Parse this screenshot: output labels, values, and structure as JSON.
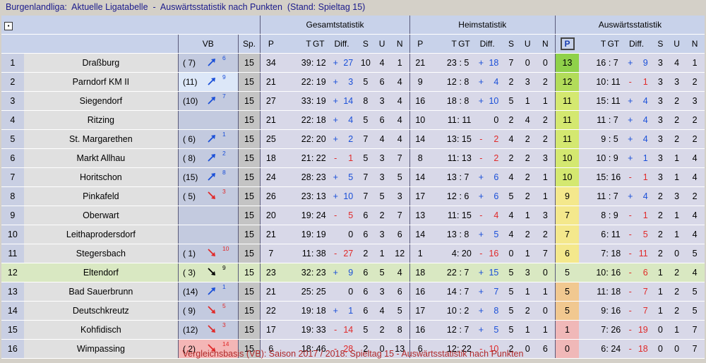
{
  "title": "Burgenlandliga:  Aktuelle Ligatabelle  -  Auswärtsstatistik nach Punkten  (Stand: Spieltag 15)",
  "footer": "Vergleichsbasis (VB): Saison 2017 / 2018: Spieltag 15 - Auswärtsstatistik nach Punkten",
  "header": {
    "groups": {
      "gesamt": "Gesamtstatistik",
      "heim": "Heimstatistik",
      "auswaerts": "Auswärtsstatistik"
    },
    "sort_icon": "▪",
    "vb": "VB",
    "sp": "Sp.",
    "p": "P",
    "t": "T",
    "gt": "GT",
    "diff": "Diff.",
    "s": "S",
    "u": "U",
    "n": "N"
  },
  "rows": [
    {
      "rank": "1",
      "team": "Draßburg",
      "vb_prev": "( 7)",
      "vb_dir": "up",
      "vb_change": "6",
      "sp": "15",
      "g": {
        "p": "34",
        "t": "39",
        "gt": "12",
        "ds": "+",
        "dv": "27",
        "s": "10",
        "u": "4",
        "n": "1"
      },
      "h": {
        "p": "21",
        "t": "23",
        "gt": "5",
        "ds": "+",
        "dv": "18",
        "s": "7",
        "u": "0",
        "n": "0"
      },
      "a": {
        "p": "13",
        "t": "16",
        "gt": "7",
        "ds": "+",
        "dv": "9",
        "s": "3",
        "u": "4",
        "n": "1"
      },
      "pc": "g1"
    },
    {
      "rank": "2",
      "team": "Parndorf KM II",
      "vb_prev": "(11)",
      "vb_dir": "up",
      "vb_change": "9",
      "sp": "15",
      "g": {
        "p": "21",
        "t": "22",
        "gt": "19",
        "ds": "+",
        "dv": "3",
        "s": "5",
        "u": "6",
        "n": "4"
      },
      "h": {
        "p": "9",
        "t": "12",
        "gt": "8",
        "ds": "+",
        "dv": "4",
        "s": "2",
        "u": "3",
        "n": "2"
      },
      "a": {
        "p": "12",
        "t": "10",
        "gt": "11",
        "ds": "-",
        "dv": "1",
        "s": "3",
        "u": "3",
        "n": "2"
      },
      "pc": "g2",
      "vbc": "blue"
    },
    {
      "rank": "3",
      "team": "Siegendorf",
      "vb_prev": "(10)",
      "vb_dir": "up",
      "vb_change": "7",
      "sp": "15",
      "g": {
        "p": "27",
        "t": "33",
        "gt": "19",
        "ds": "+",
        "dv": "14",
        "s": "8",
        "u": "3",
        "n": "4"
      },
      "h": {
        "p": "16",
        "t": "18",
        "gt": "8",
        "ds": "+",
        "dv": "10",
        "s": "5",
        "u": "1",
        "n": "1"
      },
      "a": {
        "p": "11",
        "t": "15",
        "gt": "11",
        "ds": "+",
        "dv": "4",
        "s": "3",
        "u": "2",
        "n": "3"
      },
      "pc": "g3"
    },
    {
      "rank": "4",
      "team": "Ritzing",
      "vb_prev": "",
      "vb_dir": "",
      "vb_change": "",
      "sp": "15",
      "g": {
        "p": "21",
        "t": "22",
        "gt": "18",
        "ds": "+",
        "dv": "4",
        "s": "5",
        "u": "6",
        "n": "4"
      },
      "h": {
        "p": "10",
        "t": "11",
        "gt": "11",
        "ds": "",
        "dv": "0",
        "s": "2",
        "u": "4",
        "n": "2"
      },
      "a": {
        "p": "11",
        "t": "11",
        "gt": "7",
        "ds": "+",
        "dv": "4",
        "s": "3",
        "u": "2",
        "n": "2"
      },
      "pc": "g3"
    },
    {
      "rank": "5",
      "team": "St. Margarethen",
      "vb_prev": "( 6)",
      "vb_dir": "up",
      "vb_change": "1",
      "sp": "15",
      "g": {
        "p": "25",
        "t": "22",
        "gt": "20",
        "ds": "+",
        "dv": "2",
        "s": "7",
        "u": "4",
        "n": "4"
      },
      "h": {
        "p": "14",
        "t": "13",
        "gt": "15",
        "ds": "-",
        "dv": "2",
        "s": "4",
        "u": "2",
        "n": "2"
      },
      "a": {
        "p": "11",
        "t": "9",
        "gt": "5",
        "ds": "+",
        "dv": "4",
        "s": "3",
        "u": "2",
        "n": "2"
      },
      "pc": "g3"
    },
    {
      "rank": "6",
      "team": "Markt Allhau",
      "vb_prev": "( 8)",
      "vb_dir": "up",
      "vb_change": "2",
      "sp": "15",
      "g": {
        "p": "18",
        "t": "21",
        "gt": "22",
        "ds": "-",
        "dv": "1",
        "s": "5",
        "u": "3",
        "n": "7"
      },
      "h": {
        "p": "8",
        "t": "11",
        "gt": "13",
        "ds": "-",
        "dv": "2",
        "s": "2",
        "u": "2",
        "n": "3"
      },
      "a": {
        "p": "10",
        "t": "10",
        "gt": "9",
        "ds": "+",
        "dv": "1",
        "s": "3",
        "u": "1",
        "n": "4"
      },
      "pc": "g3"
    },
    {
      "rank": "7",
      "team": "Horitschon",
      "vb_prev": "(15)",
      "vb_dir": "up",
      "vb_change": "8",
      "sp": "15",
      "g": {
        "p": "24",
        "t": "28",
        "gt": "23",
        "ds": "+",
        "dv": "5",
        "s": "7",
        "u": "3",
        "n": "5"
      },
      "h": {
        "p": "14",
        "t": "13",
        "gt": "7",
        "ds": "+",
        "dv": "6",
        "s": "4",
        "u": "2",
        "n": "1"
      },
      "a": {
        "p": "10",
        "t": "15",
        "gt": "16",
        "ds": "-",
        "dv": "1",
        "s": "3",
        "u": "1",
        "n": "4"
      },
      "pc": "g3"
    },
    {
      "rank": "8",
      "team": "Pinkafeld",
      "vb_prev": "( 5)",
      "vb_dir": "down",
      "vb_change": "3",
      "sp": "15",
      "g": {
        "p": "26",
        "t": "23",
        "gt": "13",
        "ds": "+",
        "dv": "10",
        "s": "7",
        "u": "5",
        "n": "3"
      },
      "h": {
        "p": "17",
        "t": "12",
        "gt": "6",
        "ds": "+",
        "dv": "6",
        "s": "5",
        "u": "2",
        "n": "1"
      },
      "a": {
        "p": "9",
        "t": "11",
        "gt": "7",
        "ds": "+",
        "dv": "4",
        "s": "2",
        "u": "3",
        "n": "2"
      },
      "pc": "y"
    },
    {
      "rank": "9",
      "team": "Oberwart",
      "vb_prev": "",
      "vb_dir": "",
      "vb_change": "",
      "sp": "15",
      "g": {
        "p": "20",
        "t": "19",
        "gt": "24",
        "ds": "-",
        "dv": "5",
        "s": "6",
        "u": "2",
        "n": "7"
      },
      "h": {
        "p": "13",
        "t": "11",
        "gt": "15",
        "ds": "-",
        "dv": "4",
        "s": "4",
        "u": "1",
        "n": "3"
      },
      "a": {
        "p": "7",
        "t": "8",
        "gt": "9",
        "ds": "-",
        "dv": "1",
        "s": "2",
        "u": "1",
        "n": "4"
      },
      "pc": "y"
    },
    {
      "rank": "10",
      "team": "Leithaprodersdorf",
      "vb_prev": "",
      "vb_dir": "",
      "vb_change": "",
      "sp": "15",
      "g": {
        "p": "21",
        "t": "19",
        "gt": "19",
        "ds": "",
        "dv": "0",
        "s": "6",
        "u": "3",
        "n": "6"
      },
      "h": {
        "p": "14",
        "t": "13",
        "gt": "8",
        "ds": "+",
        "dv": "5",
        "s": "4",
        "u": "2",
        "n": "2"
      },
      "a": {
        "p": "7",
        "t": "6",
        "gt": "11",
        "ds": "-",
        "dv": "5",
        "s": "2",
        "u": "1",
        "n": "4"
      },
      "pc": "y"
    },
    {
      "rank": "11",
      "team": "Stegersbach",
      "vb_prev": "( 1)",
      "vb_dir": "down",
      "vb_change": "10",
      "sp": "15",
      "g": {
        "p": "7",
        "t": "11",
        "gt": "38",
        "ds": "-",
        "dv": "27",
        "s": "2",
        "u": "1",
        "n": "12"
      },
      "h": {
        "p": "1",
        "t": "4",
        "gt": "20",
        "ds": "-",
        "dv": "16",
        "s": "0",
        "u": "1",
        "n": "7"
      },
      "a": {
        "p": "6",
        "t": "7",
        "gt": "18",
        "ds": "-",
        "dv": "11",
        "s": "2",
        "u": "0",
        "n": "5"
      },
      "pc": "y"
    },
    {
      "rank": "12",
      "team": "Eltendorf",
      "vb_prev": "( 3)",
      "vb_dir": "down-black",
      "vb_change": "9",
      "sp": "15",
      "g": {
        "p": "23",
        "t": "32",
        "gt": "23",
        "ds": "+",
        "dv": "9",
        "s": "6",
        "u": "5",
        "n": "4"
      },
      "h": {
        "p": "18",
        "t": "22",
        "gt": "7",
        "ds": "+",
        "dv": "15",
        "s": "5",
        "u": "3",
        "n": "0"
      },
      "a": {
        "p": "5",
        "t": "10",
        "gt": "16",
        "ds": "-",
        "dv": "6",
        "s": "1",
        "u": "2",
        "n": "4"
      },
      "pc": "l",
      "hl": true
    },
    {
      "rank": "13",
      "team": "Bad Sauerbrunn",
      "vb_prev": "(14)",
      "vb_dir": "up",
      "vb_change": "1",
      "sp": "15",
      "g": {
        "p": "21",
        "t": "25",
        "gt": "25",
        "ds": "",
        "dv": "0",
        "s": "6",
        "u": "3",
        "n": "6"
      },
      "h": {
        "p": "16",
        "t": "14",
        "gt": "7",
        "ds": "+",
        "dv": "7",
        "s": "5",
        "u": "1",
        "n": "1"
      },
      "a": {
        "p": "5",
        "t": "11",
        "gt": "18",
        "ds": "-",
        "dv": "7",
        "s": "1",
        "u": "2",
        "n": "5"
      },
      "pc": "o"
    },
    {
      "rank": "14",
      "team": "Deutschkreutz",
      "vb_prev": "( 9)",
      "vb_dir": "down",
      "vb_change": "5",
      "sp": "15",
      "g": {
        "p": "22",
        "t": "19",
        "gt": "18",
        "ds": "+",
        "dv": "1",
        "s": "6",
        "u": "4",
        "n": "5"
      },
      "h": {
        "p": "17",
        "t": "10",
        "gt": "2",
        "ds": "+",
        "dv": "8",
        "s": "5",
        "u": "2",
        "n": "0"
      },
      "a": {
        "p": "5",
        "t": "9",
        "gt": "16",
        "ds": "-",
        "dv": "7",
        "s": "1",
        "u": "2",
        "n": "5"
      },
      "pc": "o"
    },
    {
      "rank": "15",
      "team": "Kohfidisch",
      "vb_prev": "(12)",
      "vb_dir": "down",
      "vb_change": "3",
      "sp": "15",
      "g": {
        "p": "17",
        "t": "19",
        "gt": "33",
        "ds": "-",
        "dv": "14",
        "s": "5",
        "u": "2",
        "n": "8"
      },
      "h": {
        "p": "16",
        "t": "12",
        "gt": "7",
        "ds": "+",
        "dv": "5",
        "s": "5",
        "u": "1",
        "n": "1"
      },
      "a": {
        "p": "1",
        "t": "7",
        "gt": "26",
        "ds": "-",
        "dv": "19",
        "s": "0",
        "u": "1",
        "n": "7"
      },
      "pc": "p"
    },
    {
      "rank": "16",
      "team": "Wimpassing",
      "vb_prev": "( 2)",
      "vb_dir": "down",
      "vb_change": "14",
      "sp": "15",
      "g": {
        "p": "6",
        "t": "18",
        "gt": "46",
        "ds": "-",
        "dv": "28",
        "s": "2",
        "u": "0",
        "n": "13"
      },
      "h": {
        "p": "6",
        "t": "12",
        "gt": "22",
        "ds": "-",
        "dv": "10",
        "s": "2",
        "u": "0",
        "n": "6"
      },
      "a": {
        "p": "0",
        "t": "6",
        "gt": "24",
        "ds": "-",
        "dv": "18",
        "s": "0",
        "u": "0",
        "n": "7"
      },
      "pc": "p",
      "vbc": "red"
    }
  ]
}
